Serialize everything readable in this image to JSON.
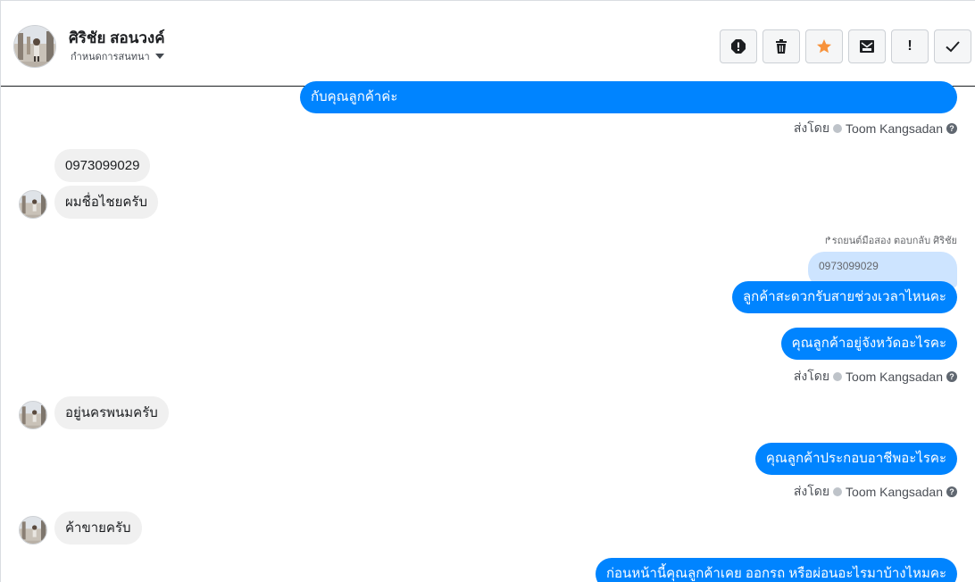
{
  "header": {
    "contact_name": "ศิริชัย สอนวงค์",
    "assign_label": "กำหนดการสนทนา",
    "actions": [
      {
        "icon": "spam-icon",
        "label": ""
      },
      {
        "icon": "trash-icon",
        "label": ""
      },
      {
        "icon": "star-icon",
        "label": "",
        "color": "#f7923b"
      },
      {
        "icon": "mark-unread-icon",
        "label": ""
      },
      {
        "icon": "important-icon",
        "label": "!"
      },
      {
        "icon": "check-icon",
        "label": ""
      }
    ]
  },
  "messages": {
    "m1": "กับคุณลูกค้าค่ะ",
    "sent_by_1": "ส่งโดย",
    "agent_1": "Toom Kangsadan",
    "m2": "0973099029",
    "m3": "ผมชื่อไชยครับ",
    "reply_note": "↱รถยนต์มือสอง ตอบกลับ ศิริชัย",
    "quote": "0973099029",
    "m4": "ลูกค้าสะดวกรับสายช่วงเวลาไหนคะ",
    "m5": "คุณลูกค้าอยู่จังหวัดอะไรคะ",
    "sent_by_2": "ส่งโดย",
    "agent_2": "Toom Kangsadan",
    "m6": "อยู่นครพนมครับ",
    "m7": "คุณลูกค้าประกอบอาชีพอะไรคะ",
    "sent_by_3": "ส่งโดย",
    "agent_3": "Toom Kangsadan",
    "m8": "ค้าขายครับ",
    "m9": "ก่อนหน้านี้คุณลูกค้าเคย ออกรถ หรือผ่อนอะไรมาบ้างไหมคะ"
  },
  "colors": {
    "outgoing": "#0084ff",
    "incoming": "#f0f0f0",
    "star": "#f7923b"
  }
}
